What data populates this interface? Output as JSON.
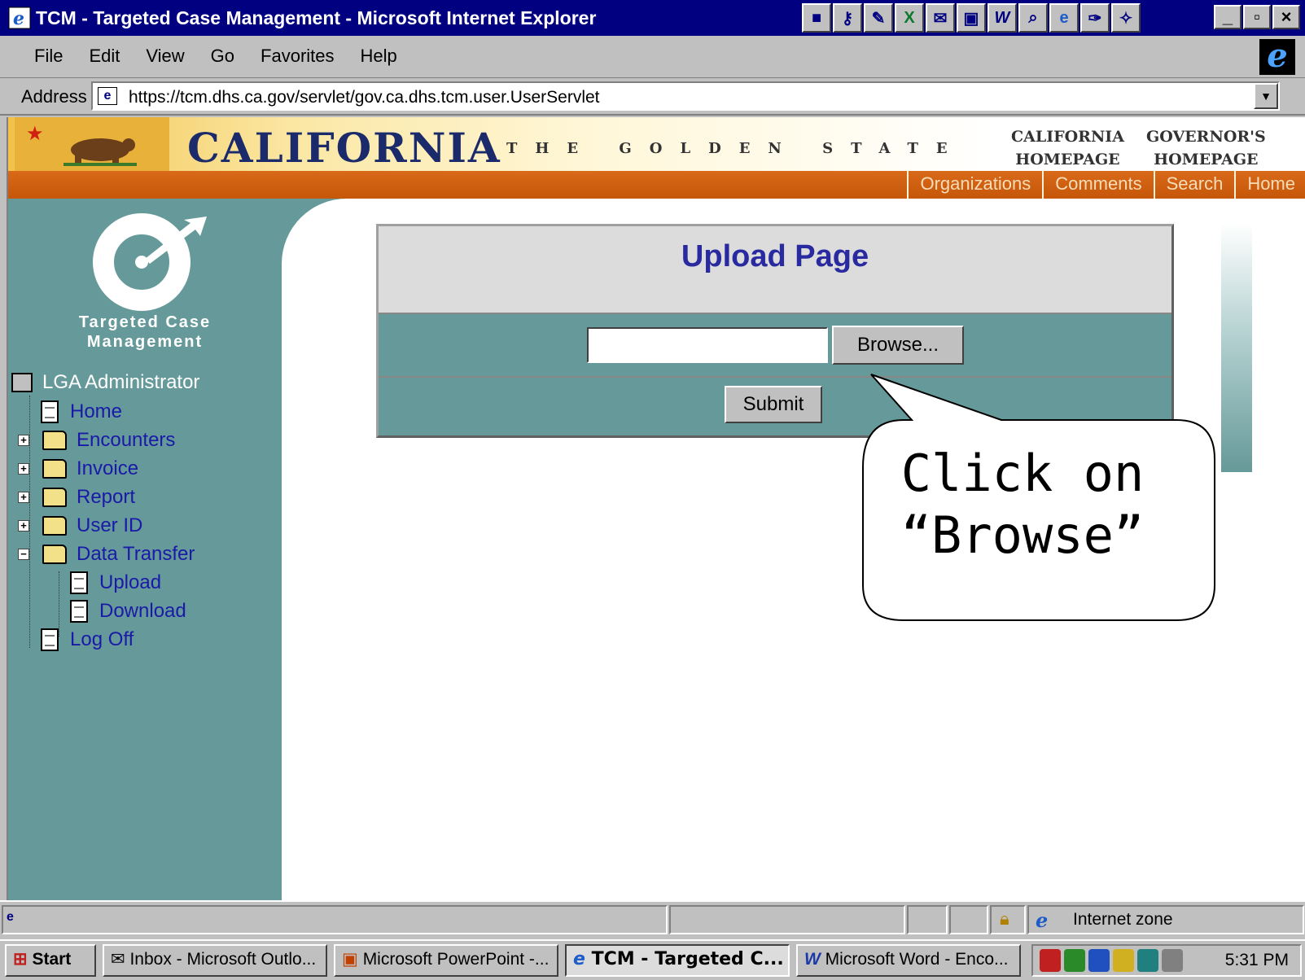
{
  "window": {
    "title": "TCM - Targeted Case Management - Microsoft Internet Explorer",
    "min_label": "_",
    "max_label": "▫",
    "close_label": "×"
  },
  "menu": [
    "File",
    "Edit",
    "View",
    "Go",
    "Favorites",
    "Help"
  ],
  "address": {
    "label": "Address",
    "url": "https://tcm.dhs.ca.gov/servlet/gov.ca.dhs.tcm.user.UserServlet"
  },
  "ca_header": {
    "wordmark": "CALIFORNIA",
    "tagline": "THE GOLDEN STATE",
    "link1_line1": "CALIFORNIA",
    "link1_line2": "HOMEPAGE",
    "link2_line1": "GOVERNOR'S",
    "link2_line2": "HOMEPAGE",
    "nav": [
      "Organizations",
      "Comments",
      "Search",
      "Home"
    ]
  },
  "sidebar": {
    "logo_line1": "Targeted Case",
    "logo_line2": "Management",
    "admin": "LGA Administrator",
    "items": [
      {
        "label": "Home",
        "type": "page"
      },
      {
        "label": "Encounters",
        "type": "folder"
      },
      {
        "label": "Invoice",
        "type": "folder"
      },
      {
        "label": "Report",
        "type": "folder"
      },
      {
        "label": "User ID",
        "type": "folder"
      },
      {
        "label": "Data Transfer",
        "type": "folder-open"
      },
      {
        "label": "Upload",
        "type": "page"
      },
      {
        "label": "Download",
        "type": "page"
      },
      {
        "label": "Log Off",
        "type": "page"
      }
    ]
  },
  "upload": {
    "title": "Upload Page",
    "file_value": "",
    "browse_label": "Browse...",
    "submit_label": "Submit"
  },
  "callout": {
    "line1": "Click on",
    "line2": "“Browse”"
  },
  "statusbar": {
    "zone": "Internet zone"
  },
  "taskbar": {
    "start": "Start",
    "tasks": [
      "Inbox - Microsoft Outlo...",
      "Microsoft PowerPoint -...",
      "TCM - Targeted C...",
      "Microsoft Word - Enco..."
    ],
    "clock": "5:31 PM"
  },
  "colors": {
    "teal": "#669999",
    "title_blue": "#2a2aa0",
    "link_blue": "#1a1aa8",
    "ca_orange": "#c65608"
  }
}
